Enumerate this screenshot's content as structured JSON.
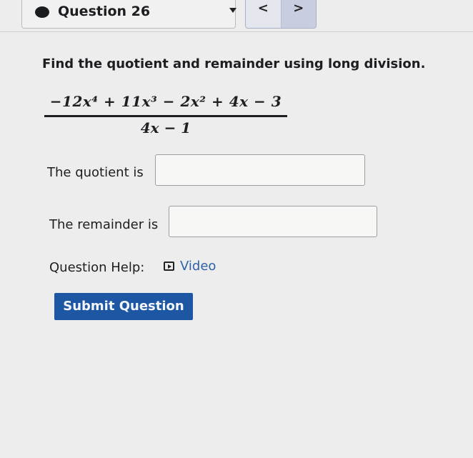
{
  "header": {
    "question_title": "Question 26",
    "prev_label": "<",
    "next_label": ">"
  },
  "problem": {
    "prompt": "Find the quotient and remainder using long division.",
    "numerator": "−12x⁴ + 11x³ − 2x² + 4x − 3",
    "denominator": "4x − 1"
  },
  "answers": {
    "quotient_label": "The quotient is",
    "quotient_value": "",
    "remainder_label": "The remainder is",
    "remainder_value": ""
  },
  "help": {
    "label": "Question Help:",
    "video_label": "Video"
  },
  "submit_label": "Submit Question",
  "colors": {
    "accent": "#1d57a3",
    "link": "#2f63a8"
  }
}
